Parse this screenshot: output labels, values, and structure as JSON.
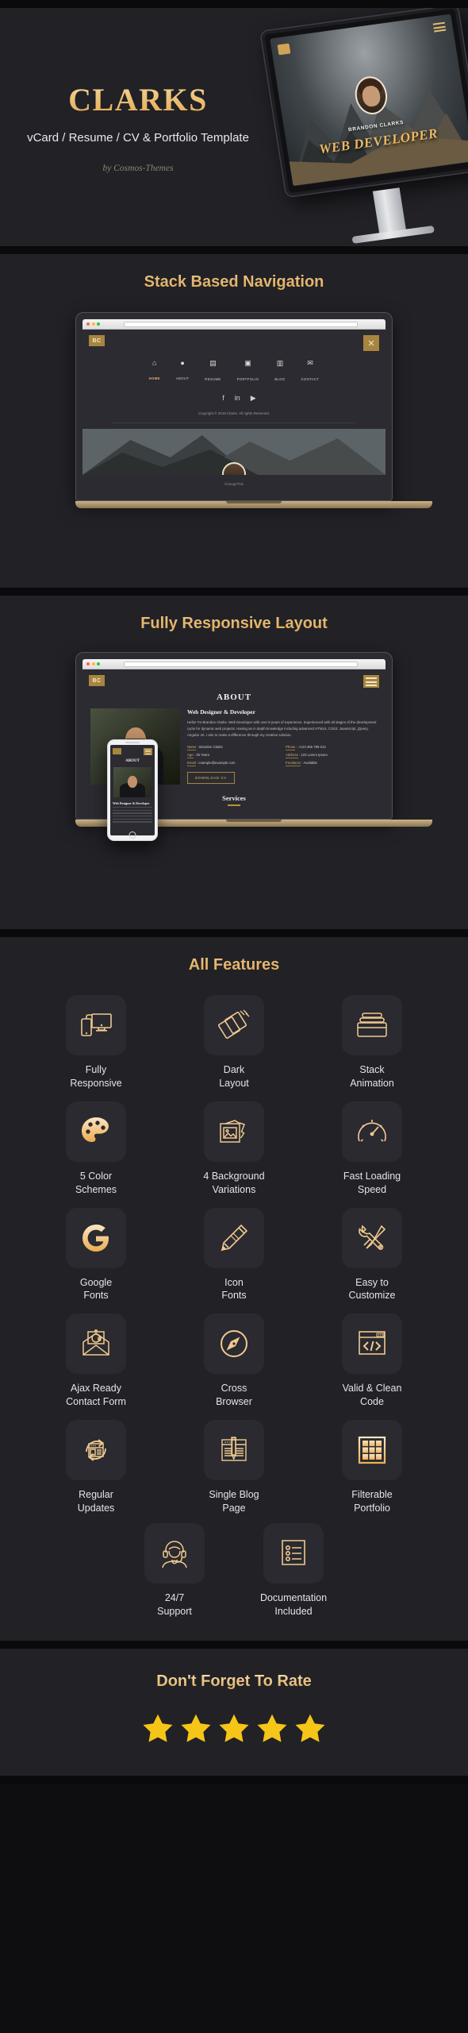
{
  "hero": {
    "brand": "CLARKS",
    "subtitle": "vCard / Resume / CV & Portfolio Template",
    "byline": "by Cosmos-Themes",
    "mockup": {
      "logo": "BC",
      "name": "BRANDON CLARKS",
      "role": "WEB DEVELOPER"
    }
  },
  "sections": {
    "stack_nav": {
      "title": "Stack Based Navigation",
      "logo": "BC",
      "close_icon": "×",
      "nav": [
        {
          "label": "HOME",
          "icon": "home-icon",
          "active": true
        },
        {
          "label": "ABOUT",
          "icon": "user-icon",
          "active": false
        },
        {
          "label": "RESUME",
          "icon": "resume-icon",
          "active": false
        },
        {
          "label": "PORTFOLIO",
          "icon": "briefcase-icon",
          "active": false
        },
        {
          "label": "BLOG",
          "icon": "blog-icon",
          "active": false
        },
        {
          "label": "CONTACT",
          "icon": "mail-icon",
          "active": false
        }
      ],
      "social": [
        "twitter-icon",
        "facebook-icon",
        "linkedin-icon",
        "youtube-icon"
      ],
      "copyright": "Copyright © 2019 Clarks. All rights Reserved.",
      "footer_note": "ChangeThis"
    },
    "responsive": {
      "title": "Fully Responsive Layout",
      "logo": "BC",
      "page_title": "ABOUT",
      "heading": "Web Designer & Developer",
      "paragraph": "Hello! I'm Brandon Clarks. Web Developer with over 8 years of experience. Experienced with all stages of the development cycle for dynamic web projects. Having an in depth knowledge including advanced HTML5, CSS3, JavaScript, jQuery, Angular JS. I aim to make a difference through my creative solution.",
      "details": [
        {
          "key": "Name",
          "value": "Brandon Clarks"
        },
        {
          "key": "Phone",
          "value": "+123 456 789 012"
        },
        {
          "key": "Age",
          "value": "26 Years"
        },
        {
          "key": "Address",
          "value": "123 Lorem Ipsum"
        },
        {
          "key": "Email",
          "value": "example@example.com"
        },
        {
          "key": "Freelance",
          "value": "Available"
        }
      ],
      "cv_button": "DOWNLOAD CV",
      "services_heading": "Services",
      "phone_title": "ABOUT",
      "phone_heading": "Web Designer & Developer"
    },
    "features": {
      "title": "All Features",
      "items": [
        {
          "label": "Fully\nResponsive",
          "icon": "devices-icon"
        },
        {
          "label": "Dark\nLayout",
          "icon": "layers-icon"
        },
        {
          "label": "Stack\nAnimation",
          "icon": "stack-icon"
        },
        {
          "label": "5 Color\nSchemes",
          "icon": "palette-icon"
        },
        {
          "label": "4 Background\nVariations",
          "icon": "images-icon"
        },
        {
          "label": "Fast Loading\nSpeed",
          "icon": "speedometer-icon"
        },
        {
          "label": "Google\nFonts",
          "icon": "google-g-icon"
        },
        {
          "label": "Icon\nFonts",
          "icon": "pencil-icon"
        },
        {
          "label": "Easy to\nCustomize",
          "icon": "tools-icon"
        },
        {
          "label": "Ajax Ready\nContact Form",
          "icon": "open-envelope-icon"
        },
        {
          "label": "Cross\nBrowser",
          "icon": "compass-icon"
        },
        {
          "label": "Valid & Clean\nCode",
          "icon": "code-window-icon"
        },
        {
          "label": "Regular\nUpdates",
          "icon": "refresh-window-icon"
        },
        {
          "label": "Single Blog\nPage",
          "icon": "blog-edit-icon"
        },
        {
          "label": "Filterable\nPortfolio",
          "icon": "grid-icon"
        },
        {
          "label": "24/7\nSupport",
          "icon": "headset-agent-icon"
        },
        {
          "label": "Documentation\nIncluded",
          "icon": "checklist-icon"
        }
      ]
    },
    "rating": {
      "title": "Don't Forget To Rate",
      "stars": 5,
      "star_color": "#f5c518"
    }
  },
  "colors": {
    "gold": "#e0b36c",
    "gold_light": "#f6dcae",
    "gold_dark": "#dfa957",
    "bg": "#212126",
    "bg_dark": "#0e0e11",
    "tile": "#2a2a30",
    "text": "#e4e4e8"
  }
}
